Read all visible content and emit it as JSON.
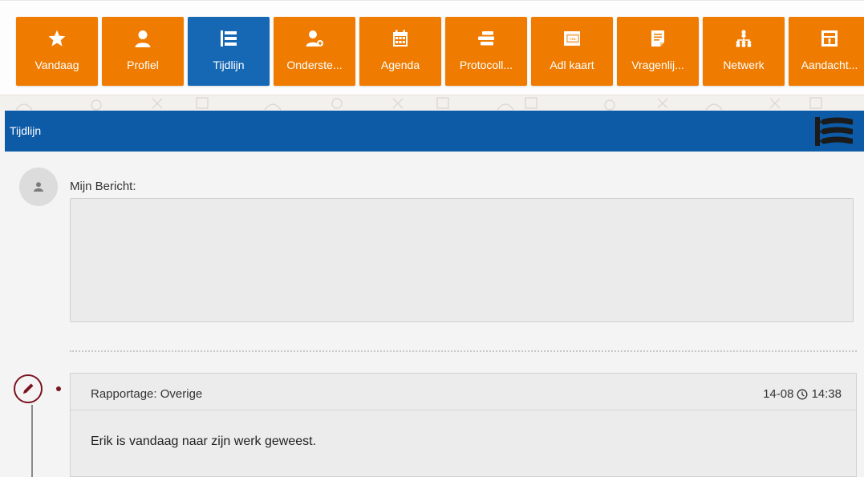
{
  "nav": {
    "items": [
      {
        "label": "Vandaag",
        "icon": "star-icon",
        "active": false
      },
      {
        "label": "Profiel",
        "icon": "person-icon",
        "active": false
      },
      {
        "label": "Tijdlijn",
        "icon": "timeline-list-icon",
        "active": true
      },
      {
        "label": "Onderste...",
        "icon": "person-plus-icon",
        "active": false
      },
      {
        "label": "Agenda",
        "icon": "calendar-icon",
        "active": false
      },
      {
        "label": "Protocoll...",
        "icon": "stack-icon",
        "active": false
      },
      {
        "label": "Adl kaart",
        "icon": "adl-card-icon",
        "active": false
      },
      {
        "label": "Vragenlij...",
        "icon": "questionnaire-icon",
        "active": false
      },
      {
        "label": "Netwerk",
        "icon": "network-icon",
        "active": false
      },
      {
        "label": "Aandacht...",
        "icon": "attention-board-icon",
        "active": false
      }
    ]
  },
  "section": {
    "title": "Tijdlijn"
  },
  "composer": {
    "label": "Mijn Bericht:",
    "value": ""
  },
  "entry": {
    "type": "Rapportage: Overige",
    "date": "14-08",
    "time": "14:38",
    "text": "Erik is vandaag naar zijn werk geweest."
  },
  "colors": {
    "tile_orange": "#ef7c00",
    "tile_active_blue": "#1768b4",
    "header_blue": "#0d5aa7",
    "entry_accent": "#7a1420"
  }
}
